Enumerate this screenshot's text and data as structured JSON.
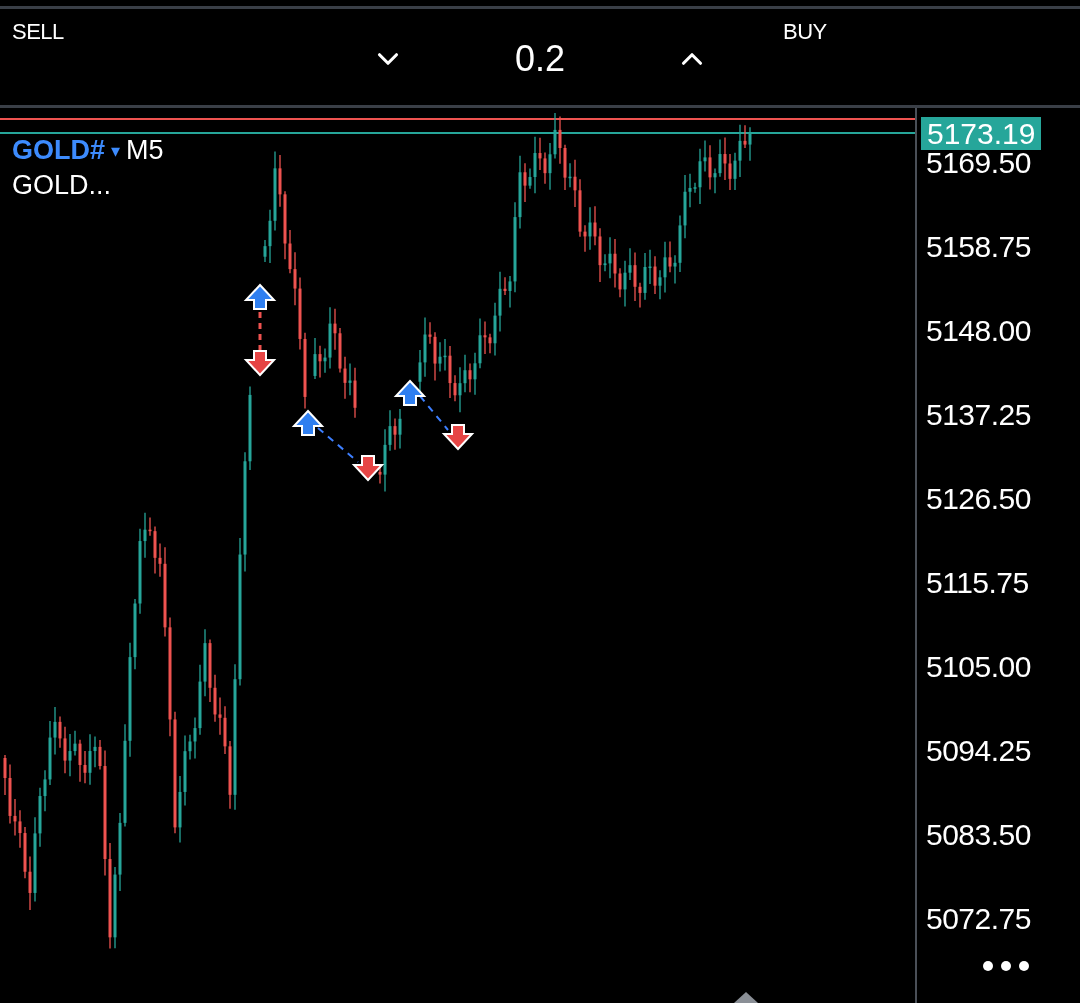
{
  "top_bar": {
    "sell_label": "SELL",
    "lot_size": "0.2",
    "buy_label": "BUY"
  },
  "chart": {
    "symbol": "GOLD#",
    "symbol_menu": "▾",
    "timeframe": "M5",
    "description": "GOLD...",
    "current_price": "5173.19",
    "price_scale": [
      "5169.50",
      "5158.75",
      "5148.00",
      "5137.25",
      "5126.50",
      "5115.75",
      "5105.00",
      "5094.25",
      "5083.50",
      "5072.75"
    ]
  }
}
